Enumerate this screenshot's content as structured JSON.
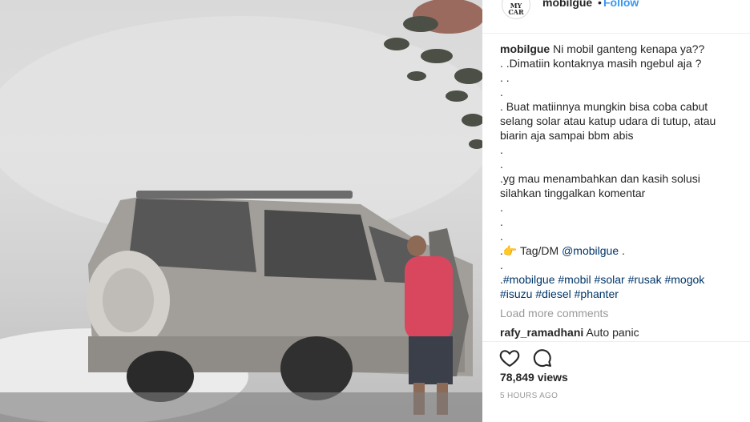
{
  "post": {
    "username": "mobilgue",
    "separator": "•",
    "follow_label": "Follow",
    "avatar_text": "MY\nCAR"
  },
  "caption": {
    "username": "mobilgue",
    "first_line": "Ni mobil ganteng kenapa ya??",
    "lines": [
      ". .Dimatiin kontaknya masih ngebul aja ?",
      ". .",
      ".",
      ". Buat matiinnya mungkin bisa coba cabut selang solar atau katup udara di tutup, atau biarin aja sampai bbm abis",
      ".",
      ".",
      ".yg mau menambahkan dan kasih solusi silahkan tinggalkan komentar",
      ".",
      ".",
      "."
    ],
    "tag_prefix": ".👉 Tag/DM ",
    "tag_mention": "@mobilgue",
    "tag_suffix": " .",
    "dot_line": ".",
    "hashtags": [
      "#mobilgue",
      "#mobil",
      "#solar",
      "#rusak",
      "#mogok",
      "#isuzu",
      "#diesel",
      "#phanter"
    ]
  },
  "load_more_label": "Load more comments",
  "next_comment": {
    "username": "rafy_ramadhani",
    "text": "Auto panic"
  },
  "actions": {
    "like_icon": "heart-outline-icon",
    "comment_icon": "speech-bubble-icon"
  },
  "stats": {
    "views": "78,849 views",
    "posted": "5 HOURS AGO"
  },
  "colors": {
    "link_blue": "#3897f0",
    "hashtag_navy": "#003569",
    "muted_gray": "#999999",
    "shirt_red": "#d9475f"
  }
}
